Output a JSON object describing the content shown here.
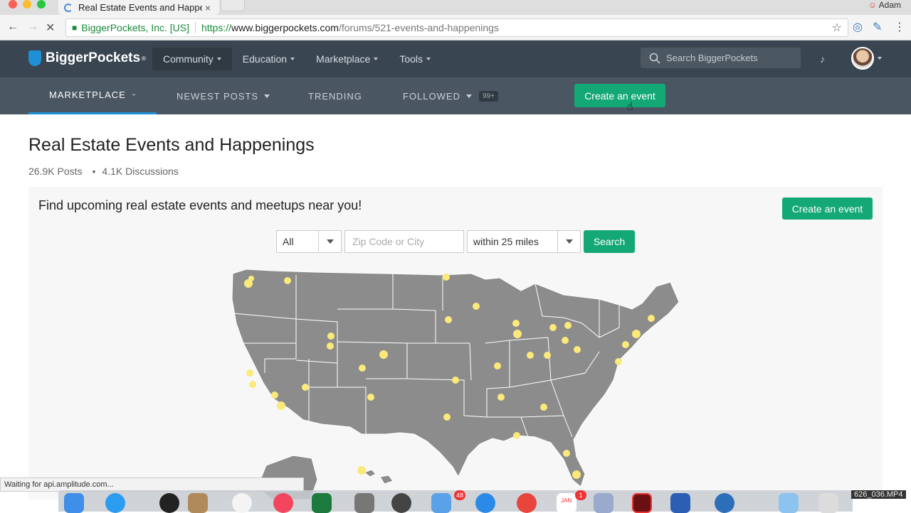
{
  "browser": {
    "tab_title": "Real Estate Events and Happenings",
    "tab_close": "×",
    "user_name": "Adam",
    "cert_label": "BiggerPockets, Inc. [US]",
    "url_scheme": "https://",
    "url_domain": "www.biggerpockets.com",
    "url_path": "/forums/521-events-and-happenings",
    "status_text": "Waiting for api.amplitude.com..."
  },
  "site": {
    "logo_text": "BiggerPockets",
    "logo_mark": "®",
    "nav": [
      {
        "label": "Community"
      },
      {
        "label": "Education"
      },
      {
        "label": "Marketplace"
      },
      {
        "label": "Tools"
      }
    ],
    "search_placeholder": "Search BiggerPockets"
  },
  "subnav": {
    "items": [
      "MARKETPLACE",
      "NEWEST POSTS",
      "TRENDING",
      "FOLLOWED"
    ],
    "followed_badge": "99+",
    "create_label": "Create an event"
  },
  "page": {
    "title": "Real Estate Events and Happenings",
    "posts": "26.9K Posts",
    "discussions": "4.1K Discussions",
    "panel_heading": "Find upcoming real estate events and meetups near you!",
    "create_label": "Create an event",
    "filter_type": "All",
    "zip_placeholder": "Zip Code or City",
    "radius": "within 25 miles",
    "search_label": "Search"
  },
  "dock": {
    "mail_badge": "48",
    "calendar_badge": "1",
    "calendar_month": "JAN"
  },
  "video_label": "626_036.MP4",
  "colors": {
    "accent_green": "#14a876",
    "header_dark": "#394651",
    "subnav_dark": "#4a5661",
    "map_state": "#8c8c8c",
    "event_marker": "#fbe97a"
  }
}
